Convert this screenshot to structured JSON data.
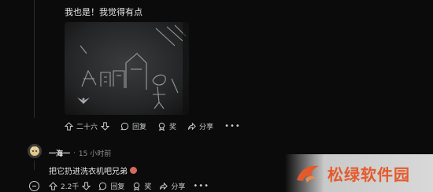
{
  "parent_comment": {
    "text": "我也是！我觉得有点",
    "actions": {
      "votes": "二十六",
      "reply": "回复",
      "award": "奖",
      "share": "分享",
      "more": "•••"
    }
  },
  "reply_comment": {
    "author": "一海一",
    "separator": "·",
    "time": "15 小时前",
    "text": "把它扔进洗衣机吧兄弟",
    "actions": {
      "votes": "2.2千",
      "reply": "回复",
      "award": "奖",
      "share": "分享",
      "more": "•••"
    }
  },
  "watermark": {
    "text": "松绿软件园",
    "color": "#e55a2b"
  },
  "icons": [
    "upvote-icon",
    "downvote-icon",
    "comment-icon",
    "award-icon",
    "share-icon",
    "more-icon",
    "collapse-icon"
  ]
}
